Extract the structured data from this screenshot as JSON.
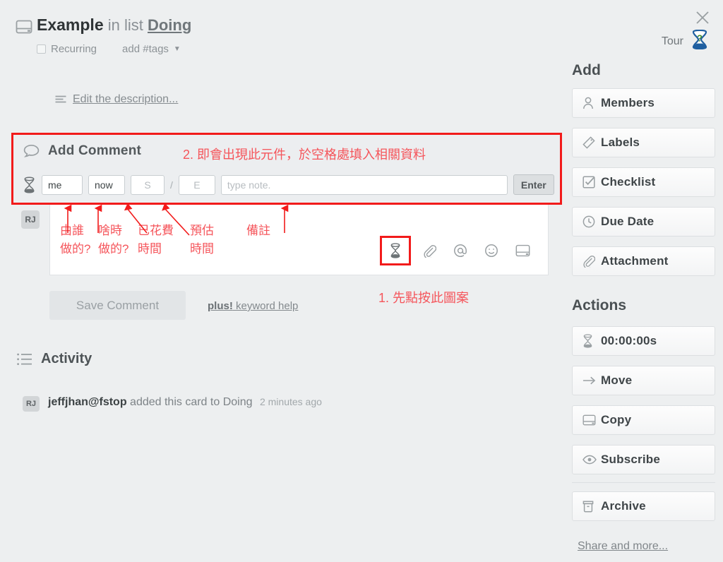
{
  "card": {
    "icon": "card-icon",
    "title": "Example",
    "in_list_label": "in list",
    "list_name": "Doing",
    "recurring_label": "Recurring",
    "tags_label": "add #tags",
    "caret": "▼",
    "description_link": "Edit the description..."
  },
  "comment": {
    "heading": "Add Comment",
    "annotation_2": "2. 即會出現此元件，於空格處填入相關資料",
    "annotation_1": "1. 先點按此圖案",
    "fields": {
      "who_value": "me",
      "when_value": "now",
      "spent_placeholder": "S",
      "separator": "/",
      "estimate_placeholder": "E",
      "note_placeholder": "type note.",
      "enter_label": "Enter"
    },
    "callouts": [
      {
        "line1": "由誰",
        "line2": "做的?"
      },
      {
        "line1": "啥時",
        "line2": "做的?"
      },
      {
        "line1": "已花費",
        "line2": "時間"
      },
      {
        "line1": "預估",
        "line2": "時間"
      },
      {
        "line1": "備註",
        "line2": ""
      }
    ],
    "tools": [
      "hourglass-icon",
      "paperclip-icon",
      "mention-icon",
      "emoji-icon",
      "card-icon"
    ],
    "save_label": "Save Comment",
    "keyword_help_bold": "plus!",
    "keyword_help_rest": " keyword help"
  },
  "activity": {
    "heading": "Activity",
    "avatar": "RJ",
    "user": "jeffjhan@fstop",
    "text": "added this card to Doing",
    "time": "2 minutes ago"
  },
  "sidebar": {
    "close": "✕",
    "tour_label": "Tour",
    "add_heading": "Add",
    "add_items": [
      {
        "label": "Members",
        "icon": "member-icon"
      },
      {
        "label": "Labels",
        "icon": "label-icon"
      },
      {
        "label": "Checklist",
        "icon": "checklist-icon"
      },
      {
        "label": "Due Date",
        "icon": "clock-icon"
      },
      {
        "label": "Attachment",
        "icon": "paperclip-icon"
      }
    ],
    "actions_heading": "Actions",
    "action_items": [
      {
        "label": "00:00:00s",
        "icon": "hourglass-icon"
      },
      {
        "label": "Move",
        "icon": "arrow-right-icon"
      },
      {
        "label": "Copy",
        "icon": "card-icon"
      },
      {
        "label": "Subscribe",
        "icon": "eye-icon"
      },
      {
        "label": "Archive",
        "icon": "archive-icon"
      }
    ],
    "share_link": "Share and more..."
  },
  "colors": {
    "annotation_red": "#f5555b",
    "highlight_red": "#f21b1b",
    "page_bg": "#edeff0",
    "tour_blue": "#1f5fa0",
    "tour_green": "#3f8a2f"
  }
}
